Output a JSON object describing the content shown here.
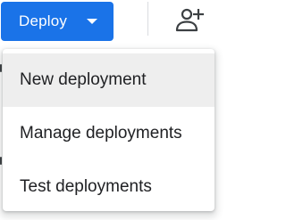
{
  "toolbar": {
    "deploy_label": "Deploy",
    "deploy_caret_icon": "caret-down-icon",
    "add_person_icon": "person-add-icon",
    "colors": {
      "primary": "#1a73e8",
      "icon": "#3c4043"
    }
  },
  "menu": {
    "items": [
      {
        "label": "New deployment",
        "highlighted": true
      },
      {
        "label": "Manage deployments",
        "highlighted": false
      },
      {
        "label": "Test deployments",
        "highlighted": false
      }
    ],
    "colors": {
      "highlight": "#eeeeee",
      "text": "#202124"
    }
  }
}
